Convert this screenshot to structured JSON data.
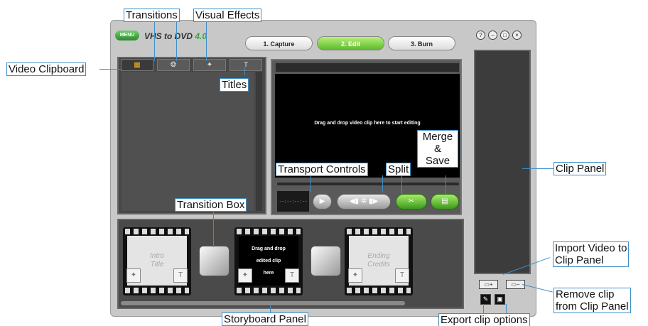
{
  "app": {
    "menu_label": "MENU",
    "logo": "VHS to DVD",
    "version": "4.0",
    "steps": [
      "1. Capture",
      "2. Edit",
      "3. Burn"
    ],
    "window_buttons": [
      "?",
      "–",
      "□",
      "×"
    ]
  },
  "left_panel": {
    "tab_icons": [
      "clipboard-icon",
      "transitions-icon",
      "effects-wand-icon",
      "titles-t-icon"
    ],
    "tab_t_glyph": "T"
  },
  "preview": {
    "message": "Drag and drop video clip here to start editing",
    "timecode": "--:--:--:--"
  },
  "storyboard": {
    "intro_placeholder": "Intro\nTitle",
    "ending_placeholder": "Ending\nCredits",
    "drop_text_lines": [
      "Drag and drop",
      "edited clip",
      "here"
    ],
    "mini_t": "T"
  },
  "callouts": {
    "transitions": "Transitions",
    "visual_effects": "Visual Effects",
    "video_clipboard": "Video Clipboard",
    "titles": "Titles",
    "merge_save": "Merge\n&\nSave",
    "transport_controls": "Transport Controls",
    "split": "Split",
    "clip_panel": "Clip Panel",
    "transition_box": "Transition Box",
    "import_video": "Import Video to\nClip Panel",
    "remove_clip": "Remove clip\nfrom Clip Panel",
    "storyboard_panel": "Storyboard Panel",
    "export_clip": "Export clip options"
  },
  "colors": {
    "accent_green": "#5dbb2a",
    "callout_border": "#3e8fc7",
    "panel_dark": "#484848"
  }
}
